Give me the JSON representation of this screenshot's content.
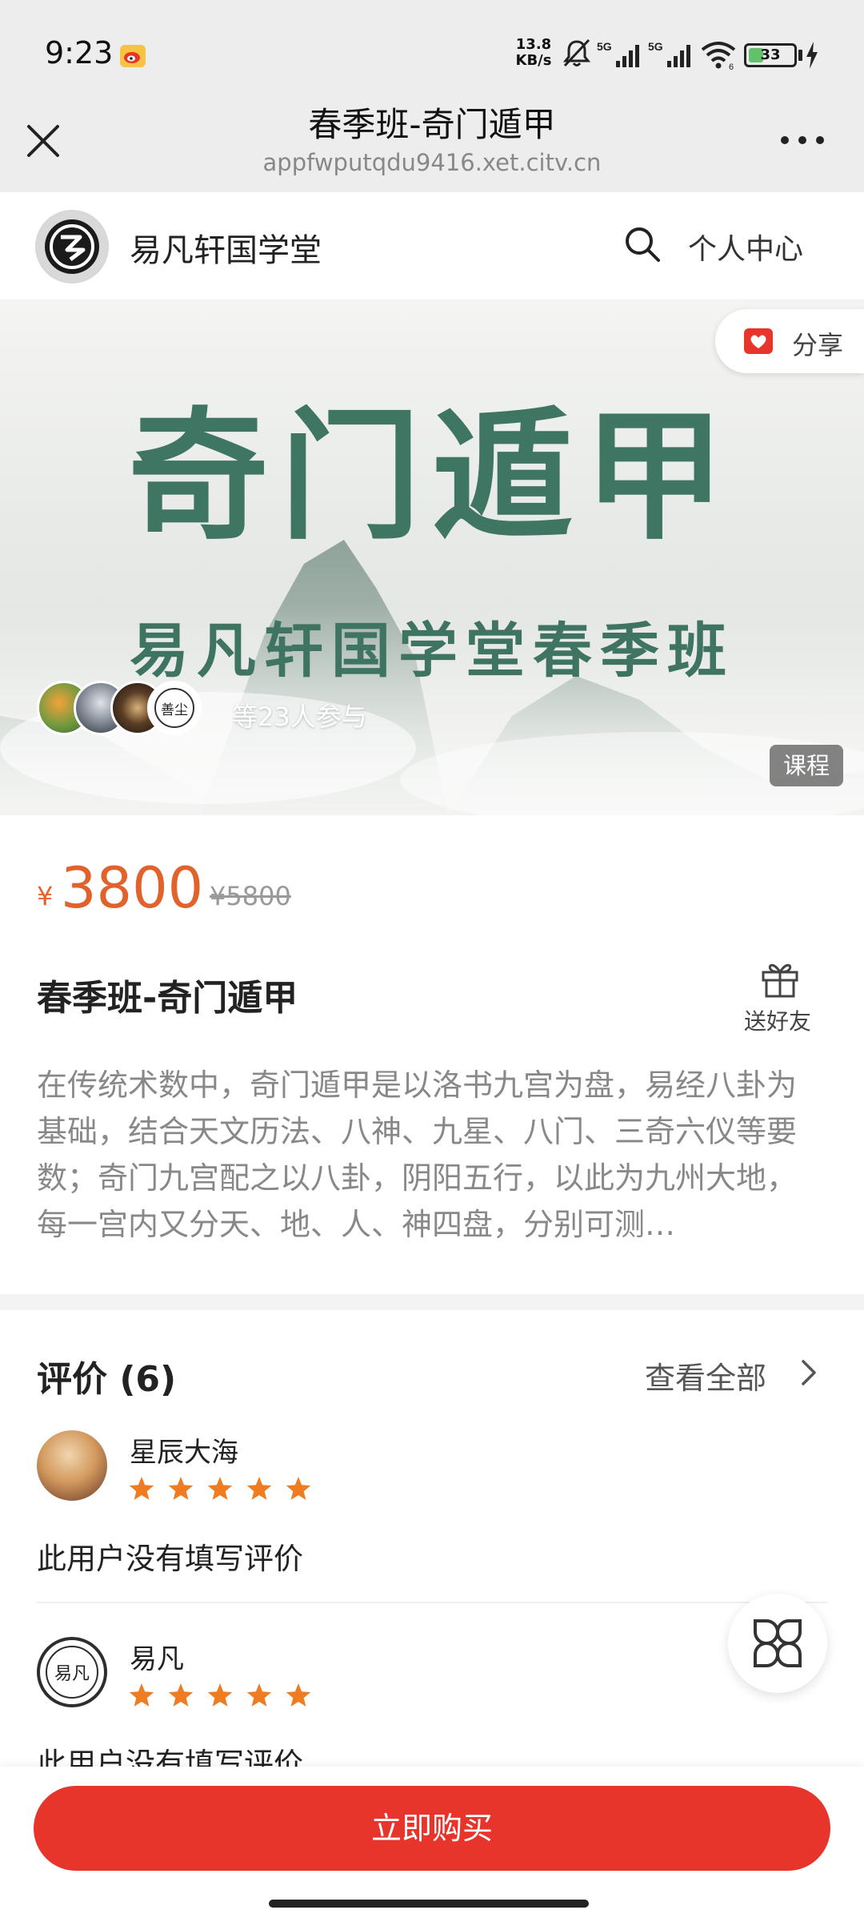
{
  "status_bar": {
    "time": "9:23",
    "net_speed_value": "13.8",
    "net_speed_unit": "KB/s",
    "signal1_label": "5G",
    "signal2_label": "5G",
    "wifi_label": "6",
    "battery_level": "33"
  },
  "title_bar": {
    "title": "春季班-奇门遁甲",
    "url": "appfwputqdu9416.xet.citv.cn"
  },
  "site_header": {
    "name": "易凡轩国学堂",
    "user_center_label": "个人中心"
  },
  "banner": {
    "share_label": "分享",
    "title": "奇门遁甲",
    "subtitle": "易凡轩国学堂春季班",
    "avatar4_text": "善尘",
    "participants_text": "等23人参与",
    "course_tag": "课程"
  },
  "product": {
    "currency": "¥",
    "price": "3800",
    "original_price": "¥5800",
    "title": "春季班-奇门遁甲",
    "gift_label": "送好友",
    "description": "在传统术数中，奇门遁甲是以洛书九宫为盘，易经八卦为基础，结合天文历法、八神、九星、八门、三奇六仪等要数；奇门九宫配之以八卦，阴阳五行，以此为九州大地，每一宫内又分天、地、人、神四盘，分别可测…"
  },
  "reviews": {
    "title": "评价 (6)",
    "view_all_label": "查看全部",
    "items": [
      {
        "name": "星辰大海",
        "rating": 5,
        "text": "此用户没有填写评价"
      },
      {
        "name": "易凡",
        "avatar_text": "易凡",
        "rating": 5,
        "text": "此用户没有填写评价"
      }
    ]
  },
  "bottom_bar": {
    "buy_label": "立即购买"
  },
  "colors": {
    "accent_red": "#e8352c",
    "price_orange": "#e2622b",
    "banner_green": "#3e7563",
    "star_orange": "#f07c22"
  },
  "icons": [
    "weibo-icon",
    "mute-icon",
    "signal-icon",
    "wifi-icon",
    "battery-icon",
    "charging-icon",
    "close-icon",
    "more-icon",
    "search-icon",
    "share-icon",
    "gift-icon",
    "chevron-right-icon",
    "star-icon",
    "grid-menu-icon"
  ]
}
